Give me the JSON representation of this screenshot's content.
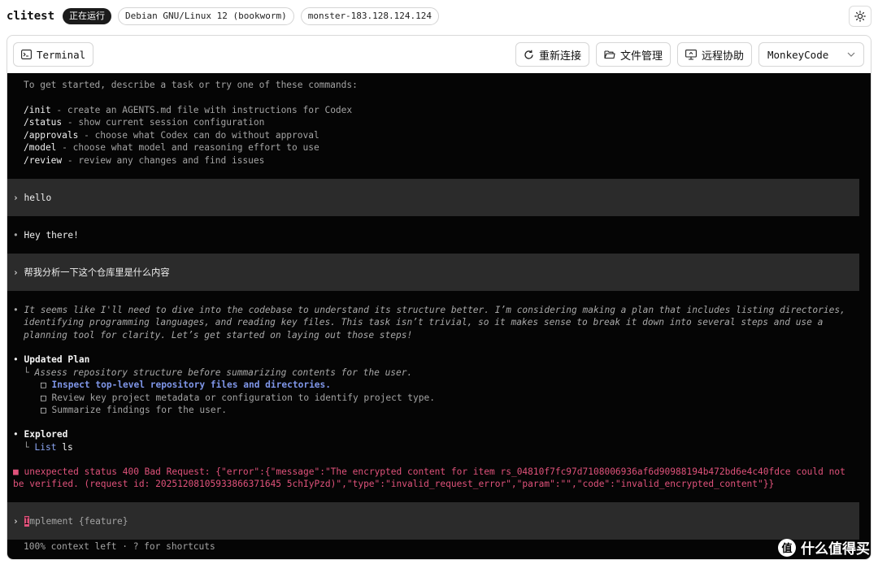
{
  "header": {
    "app_title": "clitest",
    "status_badge": "正在运行",
    "os_badge": "Debian GNU/Linux 12 (bookworm)",
    "host_badge": "monster-183.128.124.124"
  },
  "toolbar": {
    "terminal_tab": "Terminal",
    "reconnect": "重新连接",
    "file_manager": "文件管理",
    "remote_assist": "远程协助",
    "agent_select": "MonkeyCode"
  },
  "terminal": {
    "intro": "To get started, describe a task or try one of these commands:",
    "commands": [
      {
        "cmd": "/init",
        "desc": " - create an AGENTS.md file with instructions for Codex"
      },
      {
        "cmd": "/status",
        "desc": " - show current session configuration"
      },
      {
        "cmd": "/approvals",
        "desc": " - choose what Codex can do without approval"
      },
      {
        "cmd": "/model",
        "desc": " - choose what model and reasoning effort to use"
      },
      {
        "cmd": "/review",
        "desc": " - review any changes and find issues"
      }
    ],
    "prompt_symbol": "›",
    "bullet": "•",
    "user_msg_1": "hello",
    "reply_1": "Hey there!",
    "user_msg_2": "帮我分析一下这个仓库里是什么内容",
    "reasoning": [
      "It seems like I'll need to dive into the codebase to understand its structure better. I’m considering making a plan that includes listing directories,",
      "identifying programming languages, and reading key files. This task isn’t trivial, so it makes sense to break it down into several steps and use a",
      "planning tool for clarity. Let’s get started on laying out those steps!"
    ],
    "plan_title": "Updated Plan",
    "plan_branch": "└",
    "plan_note": "Assess repository structure before summarizing contents for the user.",
    "plan_checkbox": "□",
    "plan_items": [
      "Inspect top-level repository files and directories.",
      "Review key project metadata or configuration to identify project type.",
      "Summarize findings for the user."
    ],
    "explored_title": "Explored",
    "explored_cmd": "List",
    "explored_arg": "ls",
    "error_marker": "■",
    "error_lines": [
      "unexpected status 400 Bad Request: {\"error\":{\"message\":\"The encrypted content for item rs_04810f7fc97d7108006936af6d90988194b472bd6e4c40fdce could not",
      "be verified. (request id: 20251208105933866371645 5chIyPzd)\",\"type\":\"invalid_request_error\",\"param\":\"\",\"code\":\"invalid_encrypted_content\"}}"
    ],
    "input_cursor_char": "I",
    "input_placeholder": "mplement {feature}",
    "footer_hint": "100% context left · ? for shortcuts"
  },
  "watermark": {
    "logo_char": "值",
    "text": "什么值得买"
  }
}
